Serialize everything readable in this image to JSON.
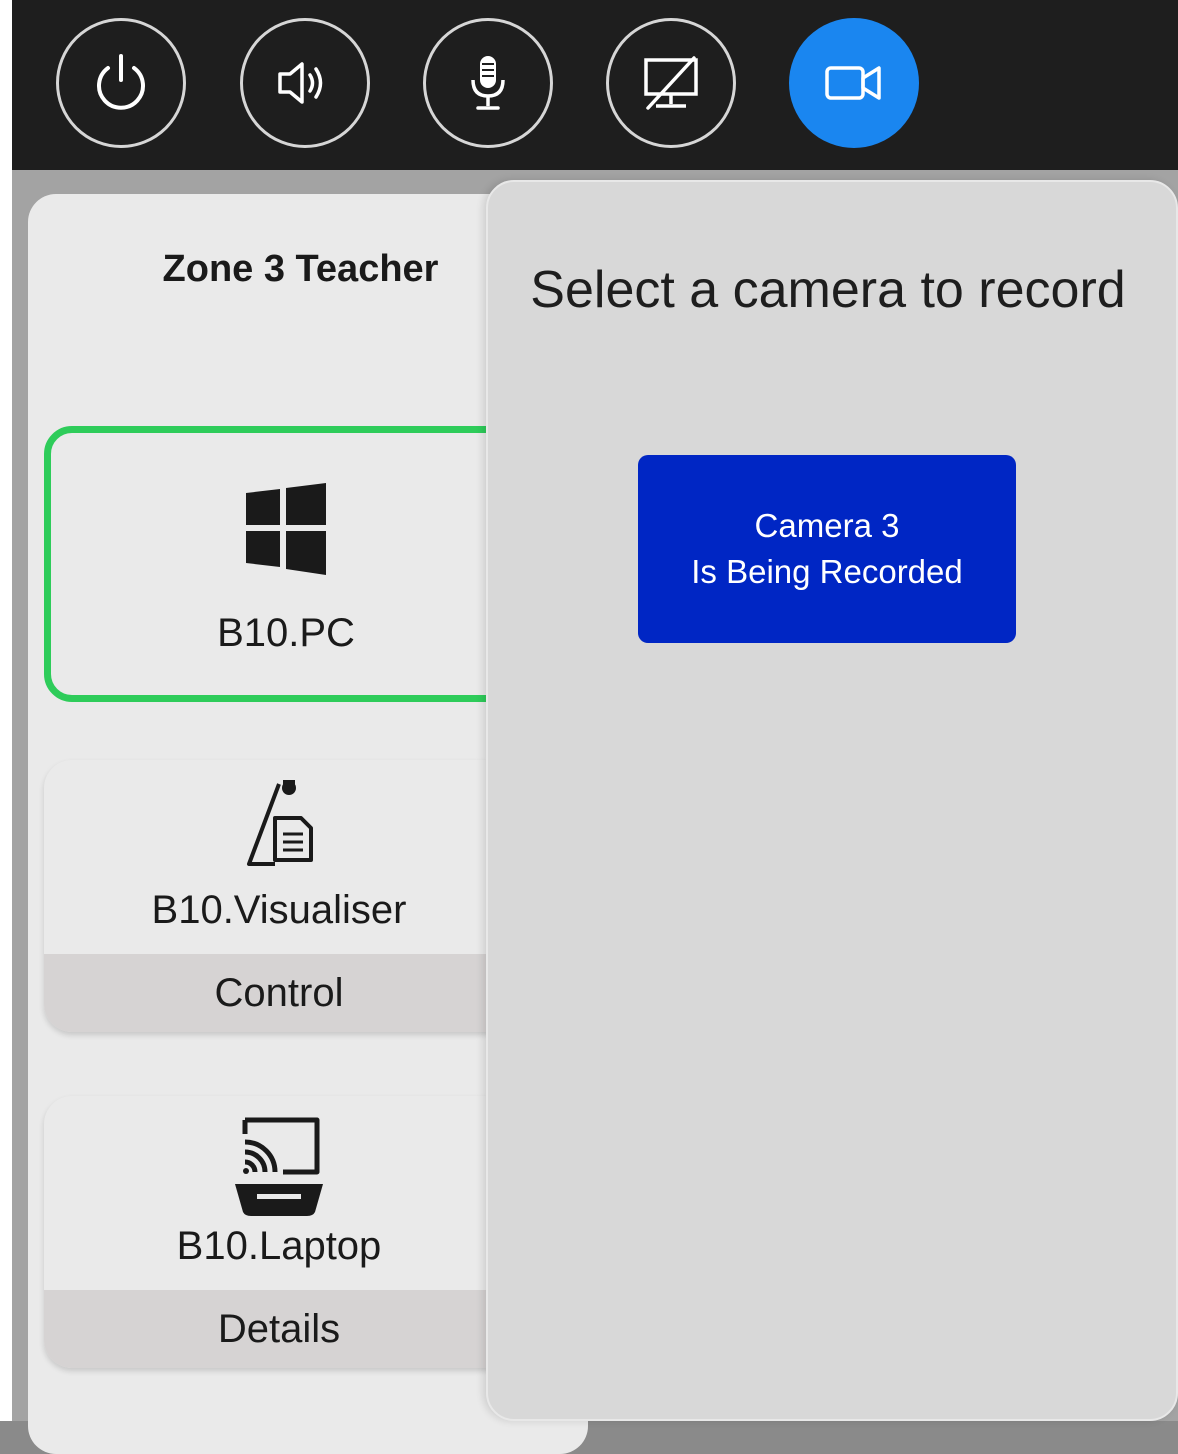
{
  "topbar": {
    "buttons": [
      {
        "icon": "power-icon",
        "active": false
      },
      {
        "icon": "speaker-icon",
        "active": false
      },
      {
        "icon": "microphone-icon",
        "active": false
      },
      {
        "icon": "display-off-icon",
        "active": false
      },
      {
        "icon": "video-camera-icon",
        "active": true
      }
    ],
    "active_color": "#1a86f0"
  },
  "zone": {
    "title": "Zone 3 Teacher"
  },
  "sources": [
    {
      "label": "B10.PC",
      "icon": "windows-icon",
      "selected": true
    },
    {
      "label": "B10.Visualiser",
      "icon": "visualiser-icon",
      "action": "Control"
    },
    {
      "label": "B10.Laptop",
      "icon": "laptop-cast-icon",
      "action": "Details"
    }
  ],
  "camera_panel": {
    "title": "Select a camera to record",
    "record_button": {
      "line1": "Camera 3",
      "line2": "Is Being Recorded"
    }
  },
  "colors": {
    "selected_border": "#2ecc5a",
    "record_button": "#0026c4"
  }
}
